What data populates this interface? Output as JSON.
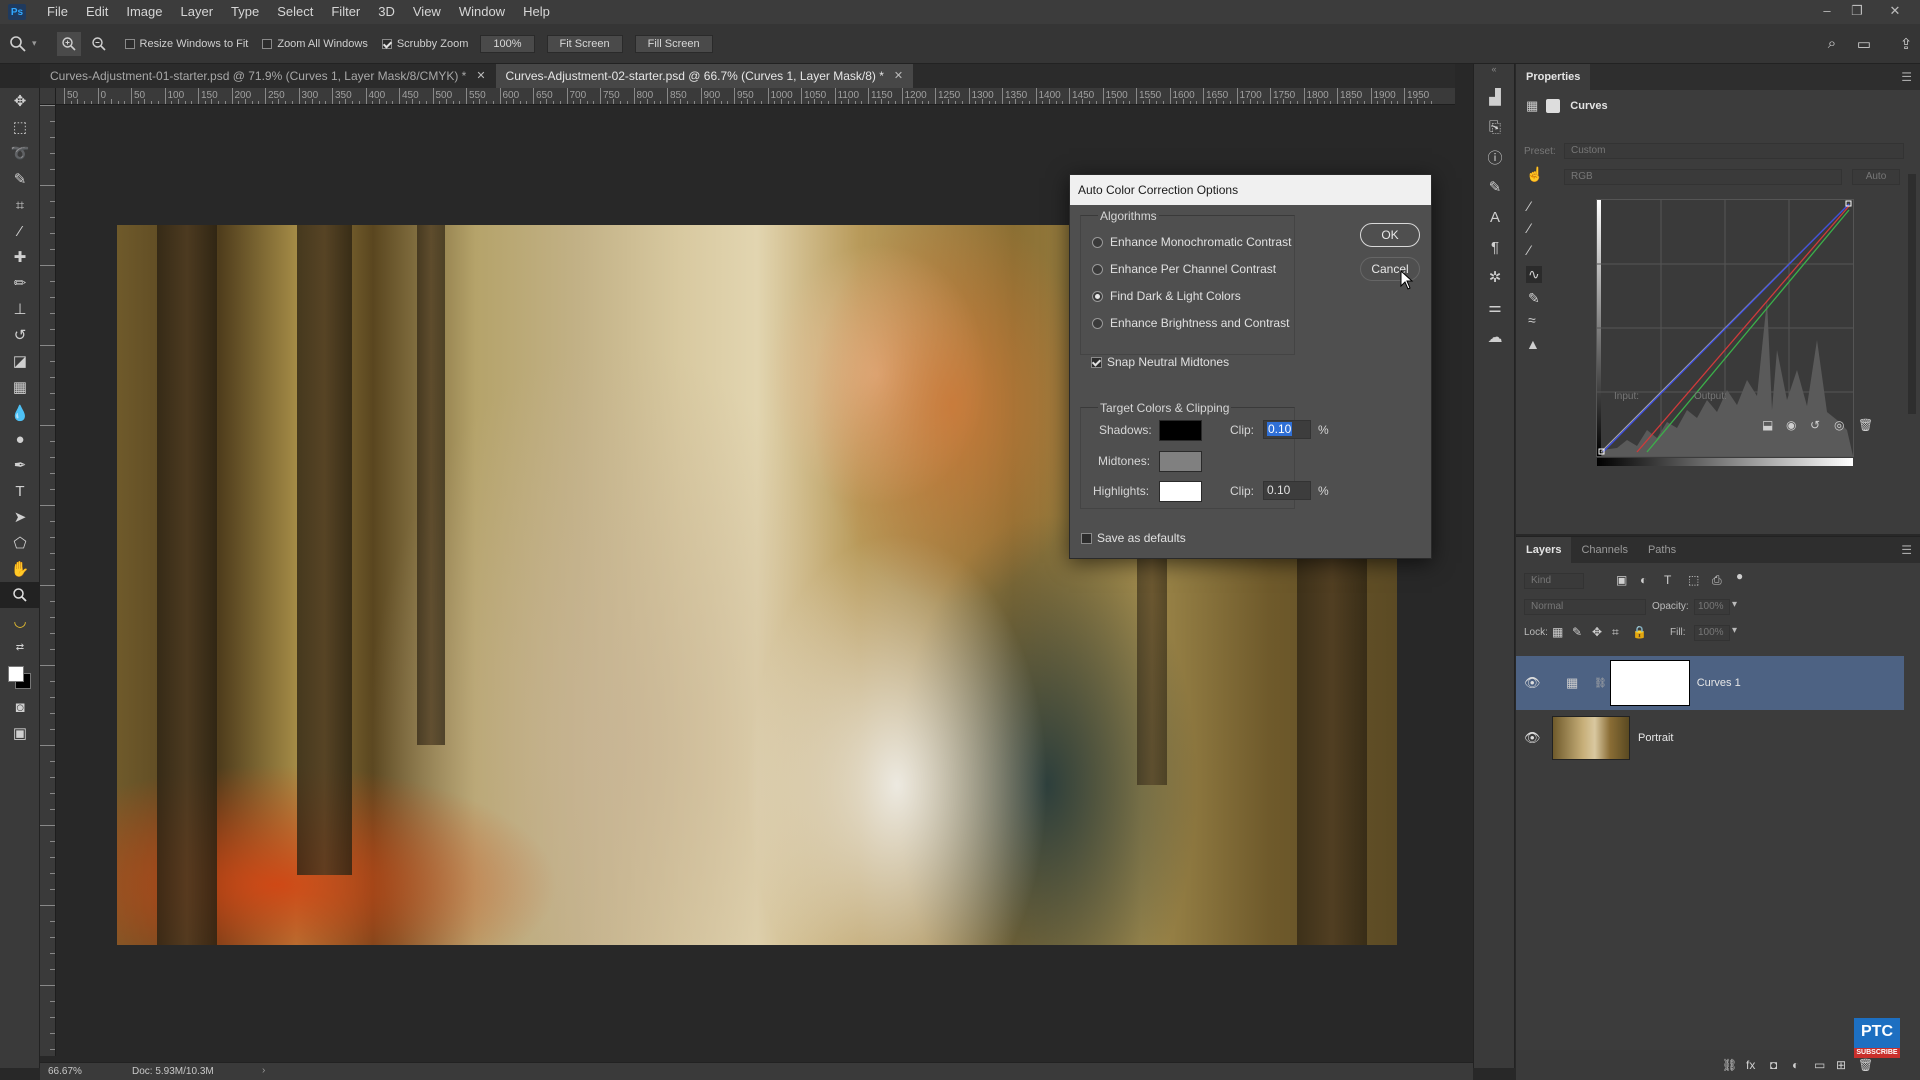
{
  "menubar": {
    "app_logo": "Ps",
    "items": [
      "File",
      "Edit",
      "Image",
      "Layer",
      "Type",
      "Select",
      "Filter",
      "3D",
      "View",
      "Window",
      "Help"
    ]
  },
  "options": {
    "resize_windows": "Resize Windows to Fit",
    "zoom_all": "Zoom All Windows",
    "scrubby_zoom": "Scrubby Zoom",
    "zoom_value": "100%",
    "fit_screen": "Fit Screen",
    "fill_screen": "Fill Screen"
  },
  "tabs": [
    {
      "title": "Curves-Adjustment-01-starter.psd @ 71.9% (Curves 1, Layer Mask/8/CMYK) *"
    },
    {
      "title": "Curves-Adjustment-02-starter.psd @ 66.7% (Curves 1, Layer Mask/8) *"
    }
  ],
  "ruler_labels": [
    "50",
    "0",
    "50",
    "100",
    "150",
    "200",
    "250",
    "300",
    "350",
    "400",
    "450",
    "500",
    "550",
    "600",
    "650",
    "700",
    "750",
    "800",
    "850",
    "900",
    "950",
    "1000",
    "1050",
    "1100",
    "1150",
    "1200",
    "1250",
    "1300",
    "1350",
    "1400",
    "1450",
    "1500",
    "1550",
    "1600",
    "1650",
    "1700",
    "1750",
    "1800",
    "1850",
    "1900",
    "1950"
  ],
  "dialog": {
    "title": "Auto Color Correction Options",
    "algorithms_legend": "Algorithms",
    "algorithms": [
      {
        "label": "Enhance Monochromatic Contrast",
        "selected": false
      },
      {
        "label": "Enhance Per Channel Contrast",
        "selected": false
      },
      {
        "label": "Find Dark & Light Colors",
        "selected": true
      },
      {
        "label": "Enhance Brightness and Contrast",
        "selected": false
      }
    ],
    "snap_neutral": "Snap Neutral Midtones",
    "snap_checked": true,
    "target_legend": "Target Colors & Clipping",
    "shadows_label": "Shadows:",
    "midtones_label": "Midtones:",
    "highlights_label": "Highlights:",
    "clip_label": "Clip:",
    "shadows_clip": "0.10",
    "highlights_clip": "0.10",
    "percent": "%",
    "shadows_color": "#000000",
    "midtones_color": "#808080",
    "highlights_color": "#ffffff",
    "save_defaults": "Save as defaults",
    "ok": "OK",
    "cancel": "Cancel"
  },
  "properties": {
    "tab": "Properties",
    "adjustment": "Curves",
    "preset_label": "Preset:",
    "preset_value": "Custom",
    "channel": "RGB",
    "auto": "Auto",
    "input_label": "Input:",
    "output_label": "Output:"
  },
  "layers": {
    "tabs": [
      "Layers",
      "Channels",
      "Paths"
    ],
    "kind": "Kind",
    "blend_mode": "Normal",
    "opacity_label": "Opacity:",
    "opacity_value": "100%",
    "lock_label": "Lock:",
    "fill_label": "Fill:",
    "fill_value": "100%",
    "items": [
      {
        "name": "Curves 1",
        "selected": true
      },
      {
        "name": "Portrait",
        "selected": false
      }
    ]
  },
  "status": {
    "zoom": "66.67%",
    "doc": "Doc: 5.93M/10.3M"
  },
  "watermark": {
    "brand": "PTC",
    "subscribe": "SUBSCRIBE"
  }
}
